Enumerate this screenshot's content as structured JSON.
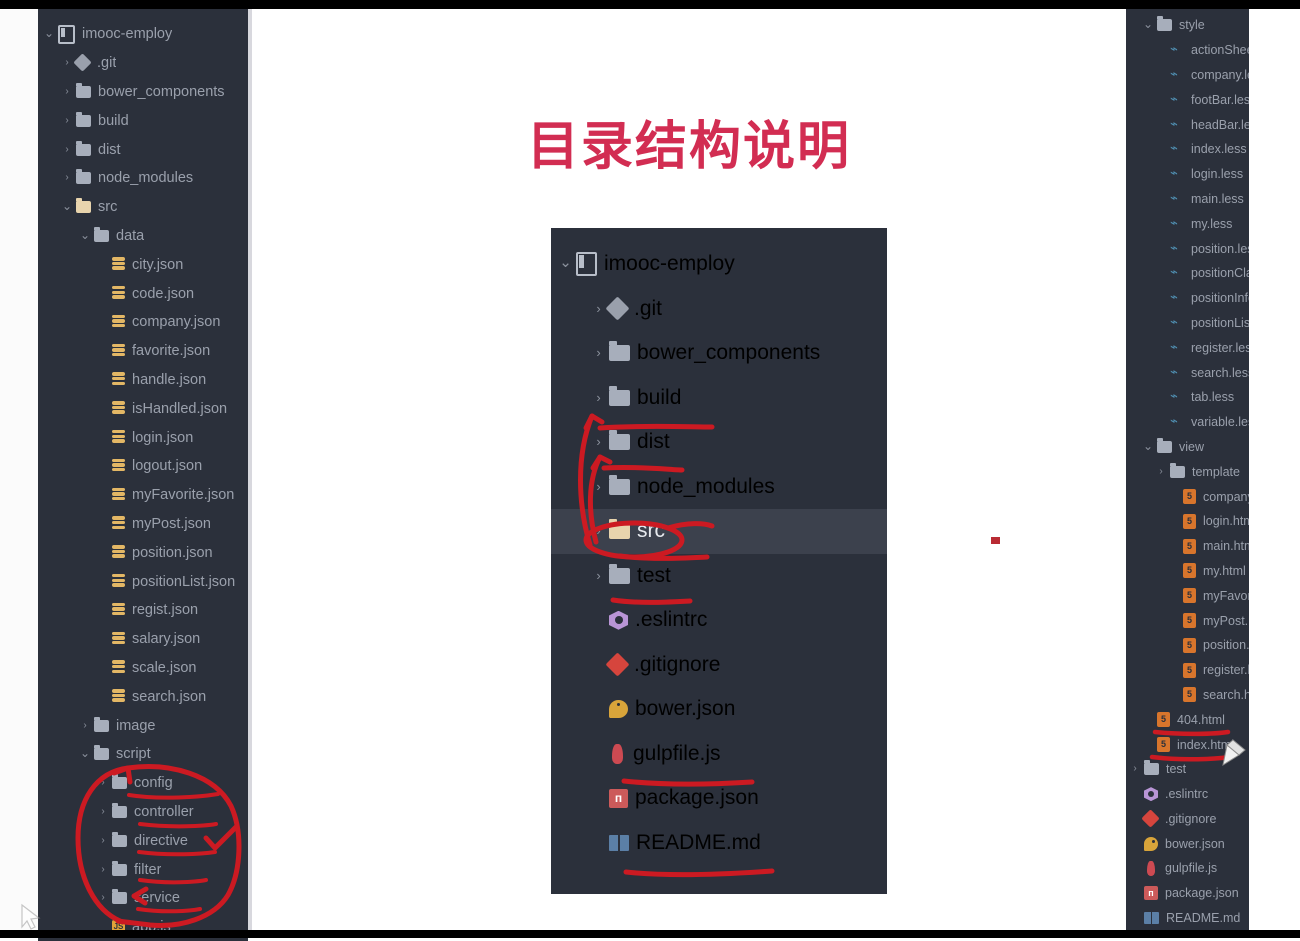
{
  "slide": {
    "title": "目录结构说明",
    "accent_color": "#d22d52"
  },
  "theme": {
    "panel_bg": "#2b303b",
    "selection_bg": "#3c414d",
    "text": "#9aa0ac",
    "folder": "#a7aebb",
    "folder_open": "#e8d4ad",
    "annotation_red": "#cc1a22"
  },
  "left_tree": {
    "items": [
      {
        "label": "imooc-employ",
        "icon": "module-icon",
        "indent": 0,
        "arrow": "down"
      },
      {
        "label": ".git",
        "icon": "git-icon",
        "indent": 1,
        "arrow": "right"
      },
      {
        "label": "bower_components",
        "icon": "folder-icon",
        "indent": 1,
        "arrow": "right"
      },
      {
        "label": "build",
        "icon": "folder-icon",
        "indent": 1,
        "arrow": "right"
      },
      {
        "label": "dist",
        "icon": "folder-icon",
        "indent": 1,
        "arrow": "right"
      },
      {
        "label": "node_modules",
        "icon": "folder-icon",
        "indent": 1,
        "arrow": "right"
      },
      {
        "label": "src",
        "icon": "folder-open-icon",
        "indent": 1,
        "arrow": "down"
      },
      {
        "label": "data",
        "icon": "folder-icon",
        "indent": 2,
        "arrow": "down"
      },
      {
        "label": "city.json",
        "icon": "json-icon",
        "indent": 3,
        "arrow": "none"
      },
      {
        "label": "code.json",
        "icon": "json-icon",
        "indent": 3,
        "arrow": "none"
      },
      {
        "label": "company.json",
        "icon": "json-icon",
        "indent": 3,
        "arrow": "none"
      },
      {
        "label": "favorite.json",
        "icon": "json-icon",
        "indent": 3,
        "arrow": "none"
      },
      {
        "label": "handle.json",
        "icon": "json-icon",
        "indent": 3,
        "arrow": "none"
      },
      {
        "label": "isHandled.json",
        "icon": "json-icon",
        "indent": 3,
        "arrow": "none"
      },
      {
        "label": "login.json",
        "icon": "json-icon",
        "indent": 3,
        "arrow": "none"
      },
      {
        "label": "logout.json",
        "icon": "json-icon",
        "indent": 3,
        "arrow": "none"
      },
      {
        "label": "myFavorite.json",
        "icon": "json-icon",
        "indent": 3,
        "arrow": "none"
      },
      {
        "label": "myPost.json",
        "icon": "json-icon",
        "indent": 3,
        "arrow": "none"
      },
      {
        "label": "position.json",
        "icon": "json-icon",
        "indent": 3,
        "arrow": "none"
      },
      {
        "label": "positionList.json",
        "icon": "json-icon",
        "indent": 3,
        "arrow": "none"
      },
      {
        "label": "regist.json",
        "icon": "json-icon",
        "indent": 3,
        "arrow": "none"
      },
      {
        "label": "salary.json",
        "icon": "json-icon",
        "indent": 3,
        "arrow": "none"
      },
      {
        "label": "scale.json",
        "icon": "json-icon",
        "indent": 3,
        "arrow": "none"
      },
      {
        "label": "search.json",
        "icon": "json-icon",
        "indent": 3,
        "arrow": "none"
      },
      {
        "label": "image",
        "icon": "folder-icon",
        "indent": 2,
        "arrow": "right"
      },
      {
        "label": "script",
        "icon": "folder-icon",
        "indent": 2,
        "arrow": "down"
      },
      {
        "label": "config",
        "icon": "folder-icon",
        "indent": 3,
        "arrow": "right"
      },
      {
        "label": "controller",
        "icon": "folder-icon",
        "indent": 3,
        "arrow": "right"
      },
      {
        "label": "directive",
        "icon": "folder-icon",
        "indent": 3,
        "arrow": "right"
      },
      {
        "label": "filter",
        "icon": "folder-icon",
        "indent": 3,
        "arrow": "right"
      },
      {
        "label": "service",
        "icon": "folder-icon",
        "indent": 3,
        "arrow": "right"
      },
      {
        "label": "app.js",
        "icon": "js-icon",
        "indent": 3,
        "arrow": "none"
      }
    ]
  },
  "center_tree": {
    "items": [
      {
        "label": "imooc-employ",
        "icon": "module-icon",
        "indent": 0,
        "arrow": "down",
        "selected": false
      },
      {
        "label": ".git",
        "icon": "git-icon",
        "indent": 1,
        "arrow": "right",
        "selected": false
      },
      {
        "label": "bower_components",
        "icon": "folder-icon",
        "indent": 1,
        "arrow": "right",
        "selected": false
      },
      {
        "label": "build",
        "icon": "folder-icon",
        "indent": 1,
        "arrow": "right",
        "selected": false
      },
      {
        "label": "dist",
        "icon": "folder-icon",
        "indent": 1,
        "arrow": "right",
        "selected": false
      },
      {
        "label": "node_modules",
        "icon": "folder-icon",
        "indent": 1,
        "arrow": "right",
        "selected": false
      },
      {
        "label": "src",
        "icon": "folder-open-icon",
        "indent": 1,
        "arrow": "right",
        "selected": true
      },
      {
        "label": "test",
        "icon": "folder-icon",
        "indent": 1,
        "arrow": "right",
        "selected": false
      },
      {
        "label": ".eslintrc",
        "icon": "eslint-icon",
        "indent": 1,
        "arrow": "none",
        "selected": false
      },
      {
        "label": ".gitignore",
        "icon": "gitignore-icon",
        "indent": 1,
        "arrow": "none",
        "selected": false
      },
      {
        "label": "bower.json",
        "icon": "bower-icon",
        "indent": 1,
        "arrow": "none",
        "selected": false
      },
      {
        "label": "gulpfile.js",
        "icon": "gulp-icon",
        "indent": 1,
        "arrow": "none",
        "selected": false
      },
      {
        "label": "package.json",
        "icon": "package-icon",
        "indent": 1,
        "arrow": "none",
        "selected": false
      },
      {
        "label": "README.md",
        "icon": "readme-icon",
        "indent": 1,
        "arrow": "none",
        "selected": false
      }
    ]
  },
  "right_tree": {
    "items": [
      {
        "label": "style",
        "icon": "folder-icon",
        "indent": 1,
        "arrow": "down"
      },
      {
        "label": "actionSheet.less",
        "icon": "less-icon",
        "indent": 2,
        "arrow": "none"
      },
      {
        "label": "company.less",
        "icon": "less-icon",
        "indent": 2,
        "arrow": "none"
      },
      {
        "label": "footBar.less",
        "icon": "less-icon",
        "indent": 2,
        "arrow": "none"
      },
      {
        "label": "headBar.less",
        "icon": "less-icon",
        "indent": 2,
        "arrow": "none"
      },
      {
        "label": "index.less",
        "icon": "less-icon",
        "indent": 2,
        "arrow": "none"
      },
      {
        "label": "login.less",
        "icon": "less-icon",
        "indent": 2,
        "arrow": "none"
      },
      {
        "label": "main.less",
        "icon": "less-icon",
        "indent": 2,
        "arrow": "none"
      },
      {
        "label": "my.less",
        "icon": "less-icon",
        "indent": 2,
        "arrow": "none"
      },
      {
        "label": "position.less",
        "icon": "less-icon",
        "indent": 2,
        "arrow": "none"
      },
      {
        "label": "positionClass.less",
        "icon": "less-icon",
        "indent": 2,
        "arrow": "none"
      },
      {
        "label": "positionInfo.less",
        "icon": "less-icon",
        "indent": 2,
        "arrow": "none"
      },
      {
        "label": "positionList.less",
        "icon": "less-icon",
        "indent": 2,
        "arrow": "none"
      },
      {
        "label": "register.less",
        "icon": "less-icon",
        "indent": 2,
        "arrow": "none"
      },
      {
        "label": "search.less",
        "icon": "less-icon",
        "indent": 2,
        "arrow": "none"
      },
      {
        "label": "tab.less",
        "icon": "less-icon",
        "indent": 2,
        "arrow": "none"
      },
      {
        "label": "variable.less",
        "icon": "less-icon",
        "indent": 2,
        "arrow": "none"
      },
      {
        "label": "view",
        "icon": "folder-icon",
        "indent": 1,
        "arrow": "down"
      },
      {
        "label": "template",
        "icon": "folder-icon",
        "indent": 2,
        "arrow": "right"
      },
      {
        "label": "company.html",
        "icon": "html-icon",
        "indent": 3,
        "arrow": "none"
      },
      {
        "label": "login.html",
        "icon": "html-icon",
        "indent": 3,
        "arrow": "none"
      },
      {
        "label": "main.html",
        "icon": "html-icon",
        "indent": 3,
        "arrow": "none"
      },
      {
        "label": "my.html",
        "icon": "html-icon",
        "indent": 3,
        "arrow": "none"
      },
      {
        "label": "myFavorite.html",
        "icon": "html-icon",
        "indent": 3,
        "arrow": "none"
      },
      {
        "label": "myPost.html",
        "icon": "html-icon",
        "indent": 3,
        "arrow": "none"
      },
      {
        "label": "position.html",
        "icon": "html-icon",
        "indent": 3,
        "arrow": "none"
      },
      {
        "label": "register.html",
        "icon": "html-icon",
        "indent": 3,
        "arrow": "none"
      },
      {
        "label": "search.html",
        "icon": "html-icon",
        "indent": 3,
        "arrow": "none"
      },
      {
        "label": "404.html",
        "icon": "html-icon",
        "indent": 1,
        "arrow": "none"
      },
      {
        "label": "index.html",
        "icon": "html-icon",
        "indent": 1,
        "arrow": "none"
      },
      {
        "label": "test",
        "icon": "folder-icon",
        "indent": 0,
        "arrow": "right"
      },
      {
        "label": ".eslintrc",
        "icon": "eslint-icon",
        "indent": 0,
        "arrow": "none"
      },
      {
        "label": ".gitignore",
        "icon": "gitignore-icon",
        "indent": 0,
        "arrow": "none"
      },
      {
        "label": "bower.json",
        "icon": "bower-icon",
        "indent": 0,
        "arrow": "none"
      },
      {
        "label": "gulpfile.js",
        "icon": "gulp-icon",
        "indent": 0,
        "arrow": "none"
      },
      {
        "label": "package.json",
        "icon": "package-icon",
        "indent": 0,
        "arrow": "none"
      },
      {
        "label": "README.md",
        "icon": "readme-icon",
        "indent": 0,
        "arrow": "none"
      }
    ]
  },
  "annotations": {
    "left_circle_note": "hand-drawn red ellipse around config / controller / directive / filter / service / app.js",
    "left_check": "red check mark beside directive",
    "center_arrows": "red arrows from src up to build and dist",
    "center_src_ellipse": "red ellipse around src row",
    "right_underlines": "red underlines beneath 404.html and index.html",
    "red_dot": "small red ink dot right of the src row"
  }
}
